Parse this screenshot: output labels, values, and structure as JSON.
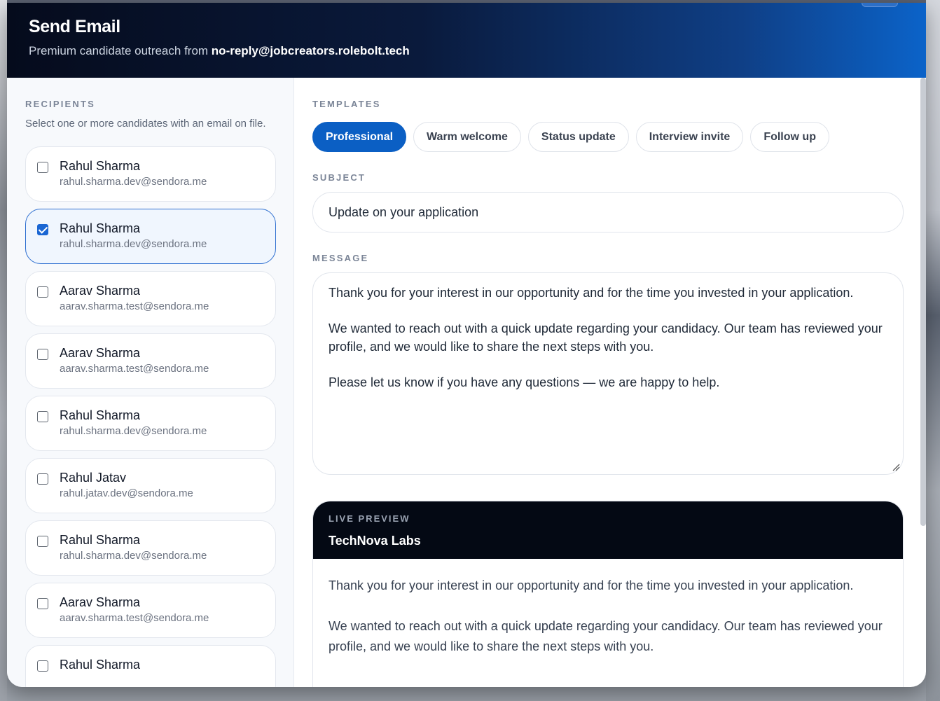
{
  "header": {
    "title": "Send Email",
    "subtitle_prefix": "Premium candidate outreach from",
    "sender": "no-reply@jobcreators.rolebolt.tech"
  },
  "recipients": {
    "label": "RECIPIENTS",
    "help": "Select one or more candidates with an email on file.",
    "items": [
      {
        "name": "Rahul Sharma",
        "email": "rahul.sharma.dev@sendora.me",
        "checked": false
      },
      {
        "name": "Rahul Sharma",
        "email": "rahul.sharma.dev@sendora.me",
        "checked": true
      },
      {
        "name": "Aarav Sharma",
        "email": "aarav.sharma.test@sendora.me",
        "checked": false
      },
      {
        "name": "Aarav Sharma",
        "email": "aarav.sharma.test@sendora.me",
        "checked": false
      },
      {
        "name": "Rahul Sharma",
        "email": "rahul.sharma.dev@sendora.me",
        "checked": false
      },
      {
        "name": "Rahul Jatav",
        "email": "rahul.jatav.dev@sendora.me",
        "checked": false
      },
      {
        "name": "Rahul Sharma",
        "email": "rahul.sharma.dev@sendora.me",
        "checked": false
      },
      {
        "name": "Aarav Sharma",
        "email": "aarav.sharma.test@sendora.me",
        "checked": false
      },
      {
        "name": "Rahul Sharma",
        "email": "",
        "checked": false
      }
    ]
  },
  "templates": {
    "label": "TEMPLATES",
    "items": [
      "Professional",
      "Warm welcome",
      "Status update",
      "Interview invite",
      "Follow up"
    ],
    "active": "Professional"
  },
  "subject": {
    "label": "SUBJECT",
    "value": "Update on your application"
  },
  "message": {
    "label": "MESSAGE",
    "paragraphs": [
      "Thank you for your interest in our opportunity and for the time you invested in your application.",
      "We wanted to reach out with a quick update regarding your candidacy. Our team has reviewed your profile, and we would like to share the next steps with you.",
      "Please let us know if you have any questions — we are happy to help."
    ]
  },
  "preview": {
    "label": "LIVE PREVIEW",
    "company": "TechNova Labs",
    "paragraphs": [
      "Thank you for your interest in our opportunity and for the time you invested in your application.",
      "We wanted to reach out with a quick update regarding your candidacy. Our team has reviewed your profile, and we would like to share the next steps with you."
    ]
  },
  "colors": {
    "accent": "#0b5fc4",
    "header_dark": "#050b1c",
    "preview_dark": "#040914"
  }
}
